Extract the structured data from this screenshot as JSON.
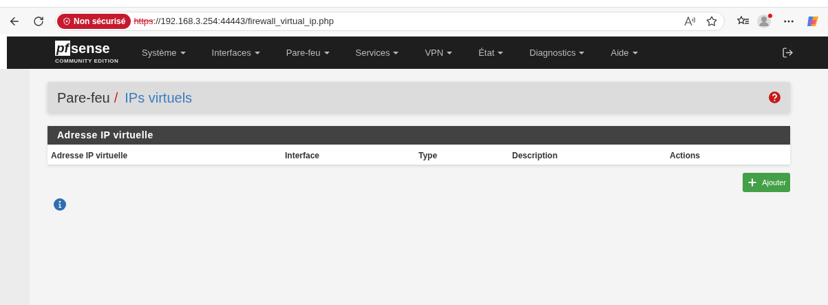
{
  "browser": {
    "security_badge": "Non sécurisé",
    "url_scheme": "https",
    "url_rest": "://192.168.3.254:44443/firewall_virtual_ip.php"
  },
  "brand": {
    "mark": "pf",
    "name": "sense",
    "edition": "COMMUNITY EDITION"
  },
  "nav": [
    "Système",
    "Interfaces",
    "Pare-feu",
    "Services",
    "VPN",
    "État",
    "Diagnostics",
    "Aide"
  ],
  "breadcrumb": {
    "parent": "Pare-feu",
    "separator": "/",
    "current": "IPs virtuels"
  },
  "panel": {
    "title": "Adresse IP virtuelle",
    "columns": [
      "Adresse IP virtuelle",
      "Interface",
      "Type",
      "Description",
      "Actions"
    ]
  },
  "add_button": "Ajouter"
}
